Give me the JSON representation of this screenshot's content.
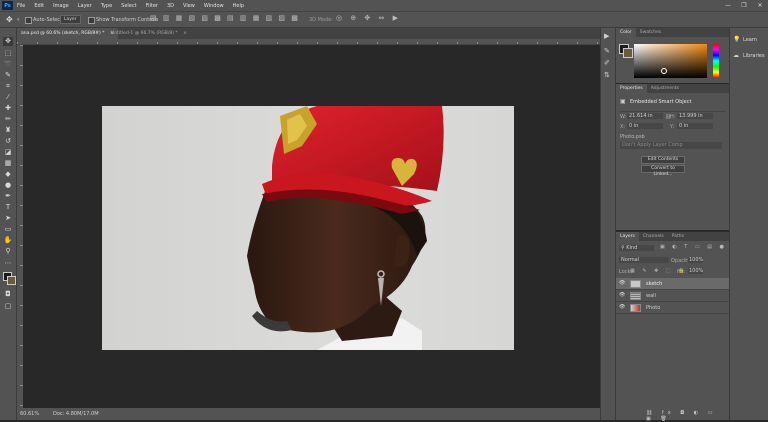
{
  "app": {
    "logo": "Ps"
  },
  "menu": [
    "File",
    "Edit",
    "Image",
    "Layer",
    "Type",
    "Select",
    "Filter",
    "3D",
    "View",
    "Window",
    "Help"
  ],
  "window_controls": [
    "—",
    "❐",
    "✕"
  ],
  "options": {
    "auto_select_label": "Auto-Select:",
    "auto_select_value": "Layer",
    "transform_label": "Show Transform Controls",
    "mode_3d": "3D Mode:"
  },
  "doc_tabs": [
    {
      "label": "ana.psd @ 60.6% (sketch, RGB/8#) *",
      "close": "×",
      "active": true
    },
    {
      "label": "Untitled-1 @ 66.7% (RGB/8) *",
      "close": "×",
      "active": false
    }
  ],
  "status": {
    "zoom": "60.61%",
    "doc": "Doc: 4.80M/17.0M"
  },
  "color_panel": {
    "tabs": [
      "Color",
      "Swatches"
    ],
    "accent": "#f08a14"
  },
  "properties": {
    "tabs": [
      "Properties",
      "Adjustments"
    ],
    "title": "Embedded Smart Object",
    "w_label": "W:",
    "w_value": "21.614 in",
    "h_label": "H:",
    "h_value": "13.999 in",
    "x_label": "X:",
    "x_value": "0 in",
    "y_label": "Y:",
    "y_value": "0 in",
    "file": "Photo.psb",
    "comp": "Don't Apply Layer Comp",
    "edit_btn": "Edit Contents",
    "convert_btn": "Convert to Linked..."
  },
  "layers": {
    "tabs": [
      "Layers",
      "Channels",
      "Paths"
    ],
    "kind": "Kind",
    "blend": "Normal",
    "opacity_label": "Opacity:",
    "opacity_value": "100%",
    "lock_label": "Lock:",
    "fill_label": "Fill:",
    "fill_value": "100%",
    "items": [
      {
        "name": "sketch",
        "selected": true
      },
      {
        "name": "wall",
        "selected": false
      },
      {
        "name": "Photo",
        "selected": false
      }
    ]
  },
  "learn": {
    "learn": "Learn",
    "libraries": "Libraries"
  }
}
